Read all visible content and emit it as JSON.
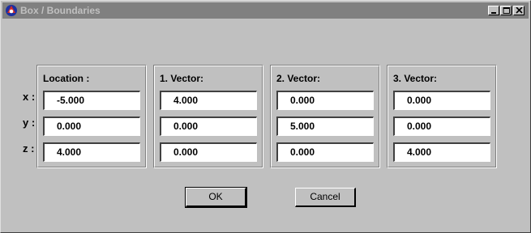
{
  "window": {
    "title": "Box / Boundaries"
  },
  "row_labels": [
    "x :",
    "y :",
    "z :"
  ],
  "groups": [
    {
      "title": "Location :",
      "values": [
        "-5.000",
        "0.000",
        "4.000"
      ]
    },
    {
      "title": "1. Vector:",
      "values": [
        "4.000",
        "0.000",
        "0.000"
      ]
    },
    {
      "title": "2. Vector:",
      "values": [
        "0.000",
        "5.000",
        "0.000"
      ]
    },
    {
      "title": "3. Vector:",
      "values": [
        "0.000",
        "0.000",
        "4.000"
      ]
    }
  ],
  "buttons": {
    "ok": "OK",
    "cancel": "Cancel"
  },
  "icons": {
    "app": "app-logo-icon",
    "minimize": "minimize-icon",
    "maximize": "maximize-icon",
    "close": "close-icon"
  },
  "colors": {
    "titlebar_inactive": "#808080",
    "face": "#c0c0c0"
  }
}
